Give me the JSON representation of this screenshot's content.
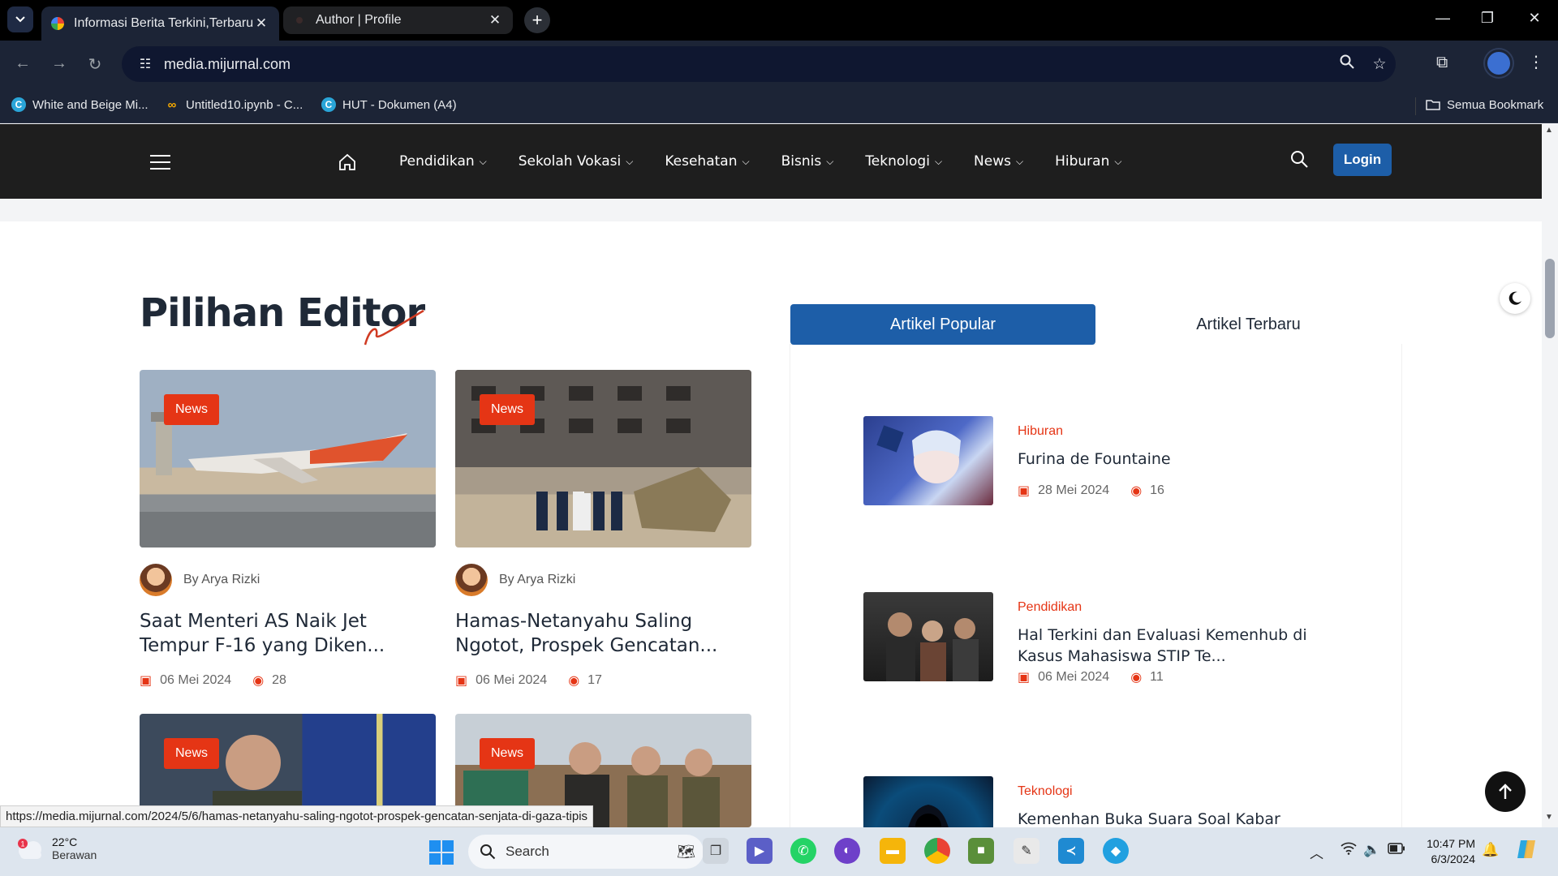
{
  "browser": {
    "tabs": [
      {
        "title": "Informasi Berita Terkini,Terbaru",
        "active": true
      },
      {
        "title": "Author | Profile",
        "active": false
      }
    ],
    "url": "media.mijurnal.com",
    "bookmarks": [
      {
        "label": "White and Beige Mi..."
      },
      {
        "label": "Untitled10.ipynb - C..."
      },
      {
        "label": "HUT - Dokumen (A4)"
      }
    ],
    "all_bookmarks_label": "Semua Bookmark",
    "status_url": "https://media.mijurnal.com/2024/5/6/hamas-netanyahu-saling-ngotot-prospek-gencatan-senjata-di-gaza-tipis"
  },
  "site": {
    "menu": [
      "Pendidikan",
      "Sekolah Vokasi",
      "Kesehatan",
      "Bisnis",
      "Teknologi",
      "News",
      "Hiburan"
    ],
    "login_label": "Login",
    "section_title": "Pilihan Editor",
    "cards": [
      {
        "badge": "News",
        "author": "By Arya Rizki",
        "headline": "Saat Menteri AS Naik Jet Tempur F-16 yang Diken...",
        "date": "06 Mei 2024",
        "views": "28"
      },
      {
        "badge": "News",
        "author": "By Arya Rizki",
        "headline": "Hamas-Netanyahu Saling Ngotot, Prospek Gencatan...",
        "date": "06 Mei 2024",
        "views": "17"
      },
      {
        "badge": "News"
      },
      {
        "badge": "News"
      }
    ],
    "side_tabs": {
      "popular": "Artikel Popular",
      "latest": "Artikel Terbaru"
    },
    "side_items": [
      {
        "category": "Hiburan",
        "title": "Furina de Fountaine",
        "date": "28 Mei 2024",
        "views": "16"
      },
      {
        "category": "Pendidikan",
        "title": "Hal Terkini dan Evaluasi Kemenhub di Kasus Mahasiswa STIP Te...",
        "date": "06 Mei 2024",
        "views": "11"
      },
      {
        "category": "Teknologi",
        "title": "Kemenhan Buka Suara Soal Kabar Website Diretas Hacker"
      }
    ]
  },
  "taskbar": {
    "weather_temp": "22°C",
    "weather_cond": "Berawan",
    "weather_badge": "1",
    "search_label": "Search",
    "time": "10:47 PM",
    "date": "6/3/2024"
  },
  "colors": {
    "accent": "#1d5ea8",
    "badge": "#e53515",
    "nav_bg": "#1e1e1e"
  }
}
